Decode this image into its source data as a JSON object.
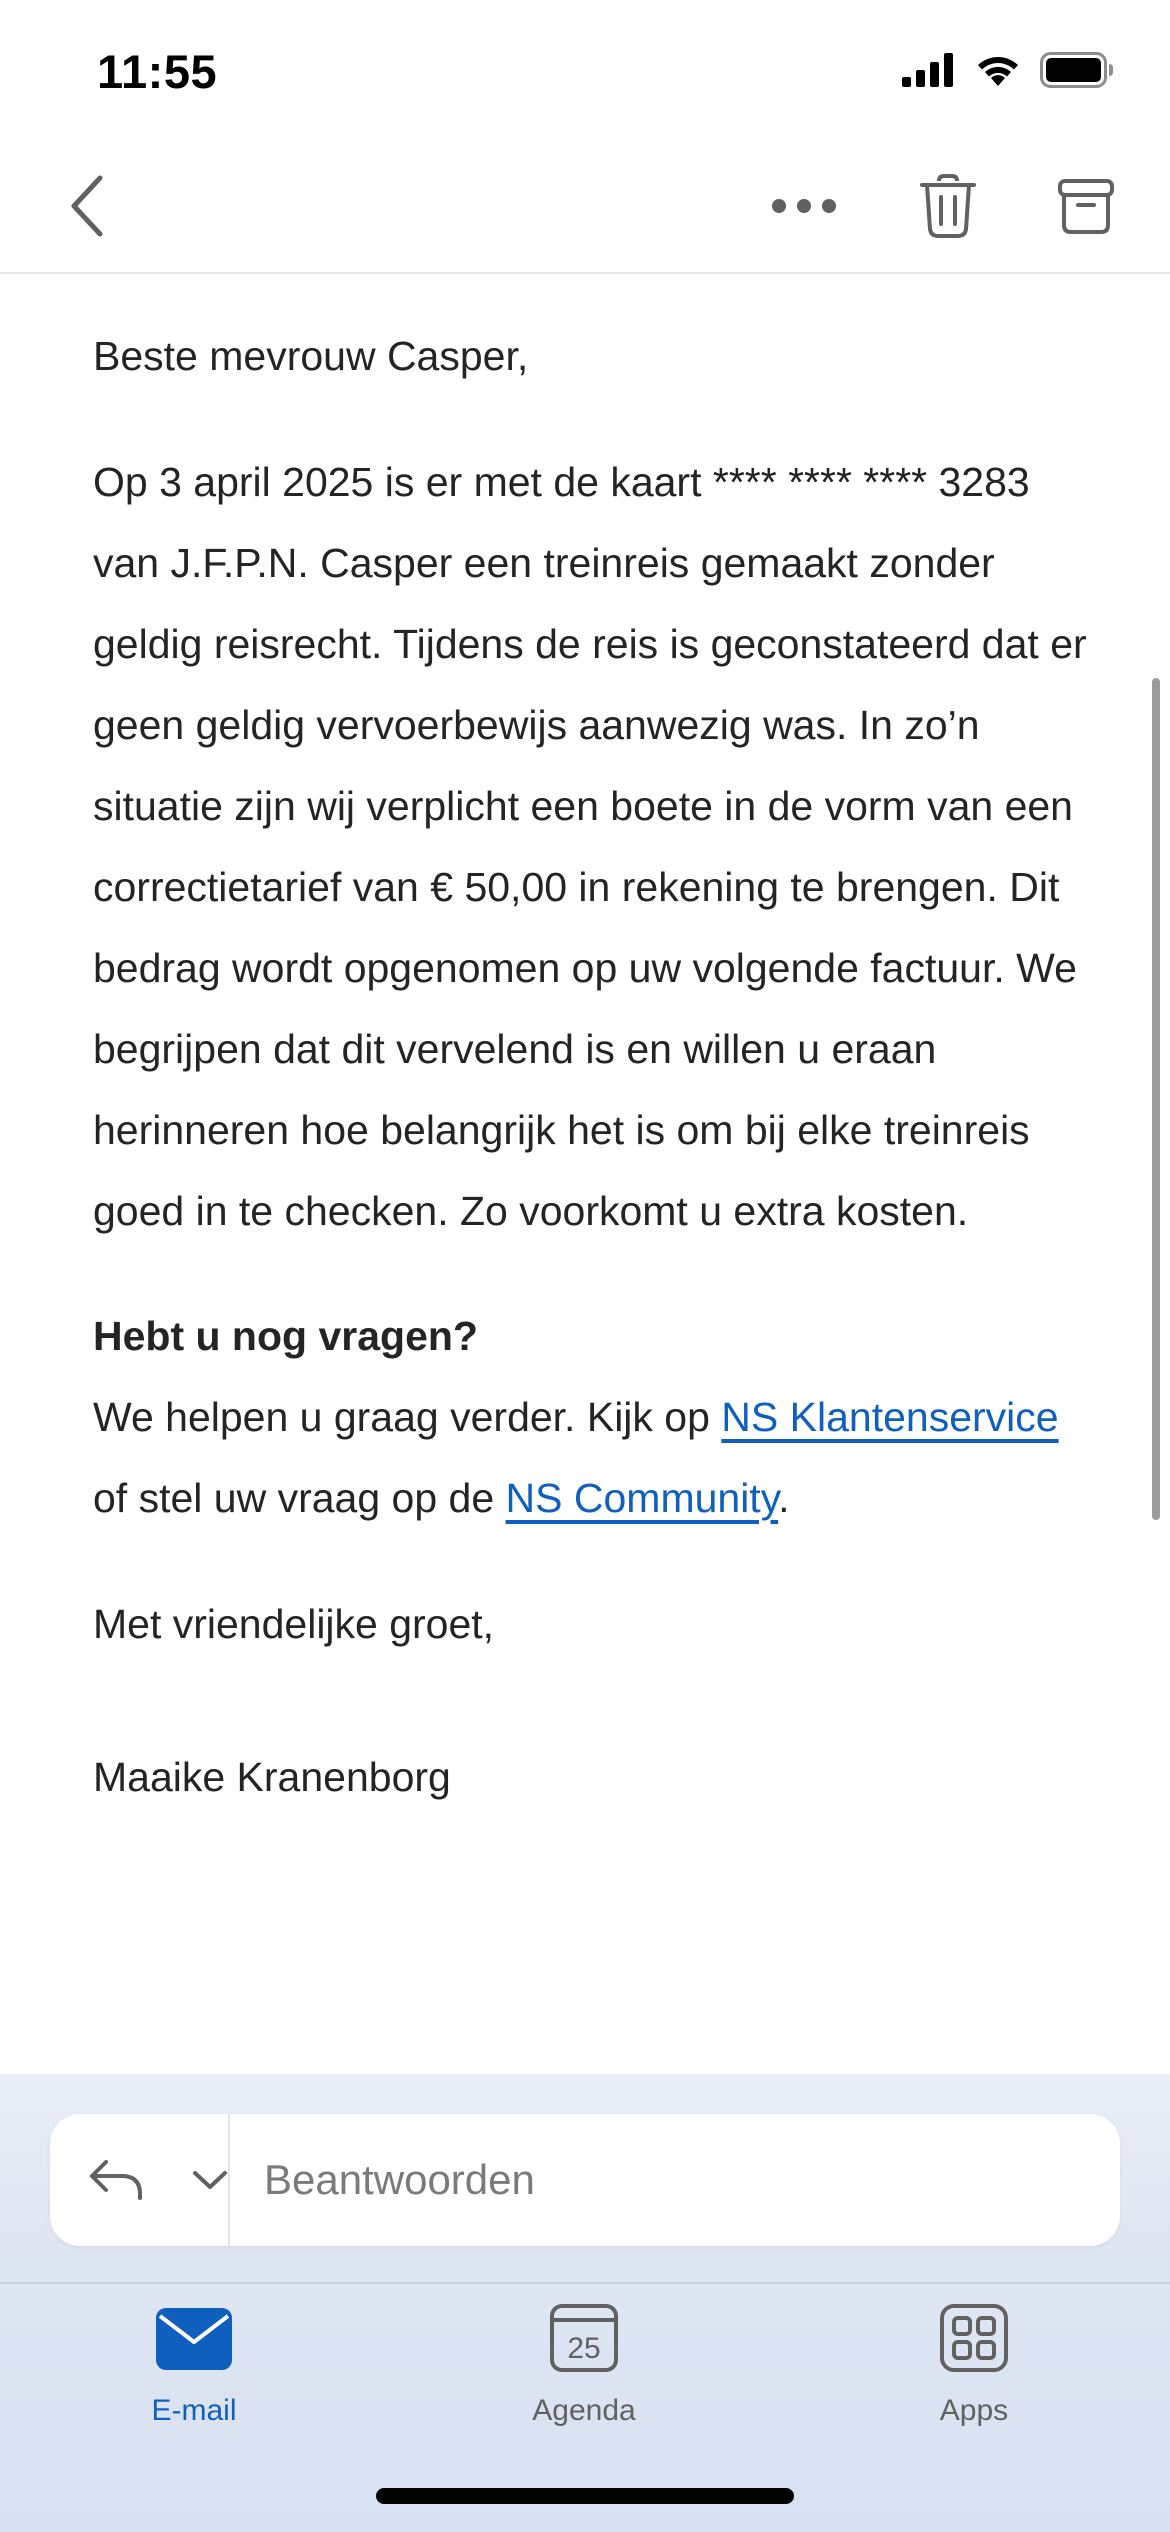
{
  "status_bar": {
    "time": "11:55"
  },
  "mail": {
    "greeting": "Beste mevrouw Casper,",
    "main_paragraph": "Op 3 april 2025 is er met de kaart **** **** **** 3283 van J.F.P.N. Casper een treinreis gemaakt zonder geldig reisrecht. Tijdens de reis is geconstateerd dat er geen geldig vervoerbewijs aanwezig was. In zo’n situatie zijn wij verplicht een boete in de vorm van een correctietarief van € 50,00 in rekening te brengen. Dit bedrag wordt opgenomen op uw volgende factuur. We begrijpen dat dit vervelend is en willen u eraan herinneren hoe belangrijk het is om bij elke treinreis goed in te checken. Zo voorkomt u extra kosten.",
    "questions_heading": "Hebt u nog vragen?",
    "help_text_1": "We helpen u graag verder. Kijk op ",
    "help_link_1": "NS Klantenservice",
    "help_text_2": " of stel uw vraag op de ",
    "help_link_2": "NS Community",
    "help_text_3": ".",
    "closing": "Met vriendelijke groet,",
    "signature": "Maaike Kranenborg"
  },
  "reply": {
    "placeholder": "Beantwoorden"
  },
  "tabs": [
    {
      "label": "E-mail",
      "active": true
    },
    {
      "label": "Agenda",
      "active": false,
      "day": "25"
    },
    {
      "label": "Apps",
      "active": false
    }
  ],
  "colors": {
    "accent": "#0f5fbf",
    "text": "#242424",
    "icon": "#616161"
  },
  "icons": {
    "back": "chevron-left-icon",
    "more": "more-horizontal-icon",
    "delete": "trash-icon",
    "archive": "archive-icon",
    "reply": "reply-arrow-icon",
    "reply_options": "chevron-down-icon"
  }
}
